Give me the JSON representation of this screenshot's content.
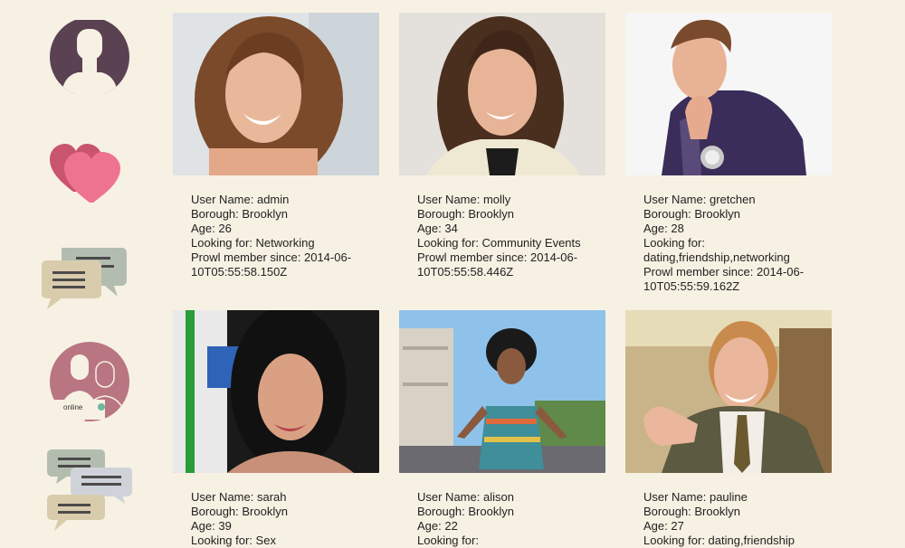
{
  "nav": {
    "online_label": "online"
  },
  "labels": {
    "user_name": "User Name: ",
    "borough": "Borough: ",
    "age": "Age: ",
    "looking_for": "Looking for: ",
    "member_since": "Prowl member since: "
  },
  "users": [
    {
      "user_name": "admin",
      "borough": "Brooklyn",
      "age": "26",
      "looking_for": "Networking",
      "member_since": "2014-06-10T05:55:58.150Z"
    },
    {
      "user_name": "molly",
      "borough": "Brooklyn",
      "age": "34",
      "looking_for": "Community Events",
      "member_since": "2014-06-10T05:55:58.446Z"
    },
    {
      "user_name": "gretchen",
      "borough": "Brooklyn",
      "age": "28",
      "looking_for": "dating,friendship,networking",
      "member_since": "2014-06-10T05:55:59.162Z"
    },
    {
      "user_name": "sarah",
      "borough": "Brooklyn",
      "age": "39",
      "looking_for": "Sex",
      "member_since": ""
    },
    {
      "user_name": "alison",
      "borough": "Brooklyn",
      "age": "22",
      "looking_for": "",
      "member_since": ""
    },
    {
      "user_name": "pauline",
      "borough": "Brooklyn",
      "age": "27",
      "looking_for": "dating,friendship",
      "member_since": ""
    }
  ],
  "colors": {
    "background": "#f7f1e3",
    "profile_icon": "#5a4253",
    "heart": "#ec6f8d",
    "online_icon": "#b97582",
    "online_dot": "#6fb79f"
  }
}
